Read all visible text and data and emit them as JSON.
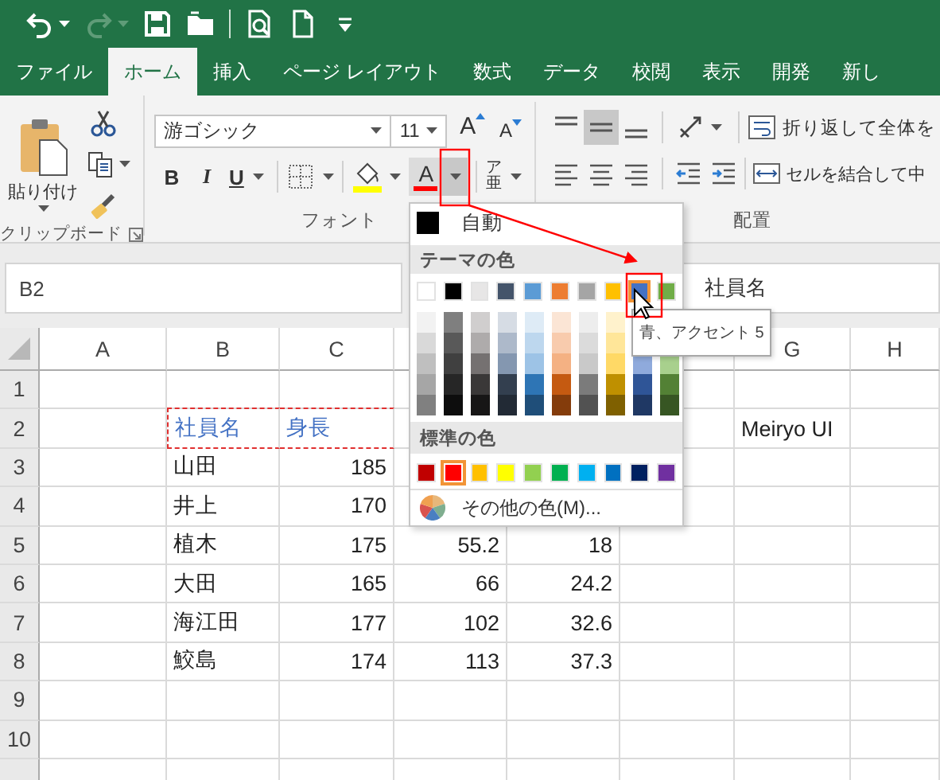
{
  "quick_access": [
    {
      "kind": "undo",
      "disabled": false
    },
    {
      "kind": "redo",
      "disabled": true
    },
    {
      "kind": "save",
      "disabled": false
    },
    {
      "kind": "open",
      "disabled": false
    },
    {
      "kind": "print_preview",
      "disabled": false
    },
    {
      "kind": "new",
      "disabled": false
    },
    {
      "kind": "customize",
      "disabled": false
    }
  ],
  "tabs": [
    {
      "label": "ファイル",
      "selected": false
    },
    {
      "label": "ホーム",
      "selected": true
    },
    {
      "label": "挿入",
      "selected": false
    },
    {
      "label": "ページ レイアウト",
      "selected": false
    },
    {
      "label": "数式",
      "selected": false
    },
    {
      "label": "データ",
      "selected": false
    },
    {
      "label": "校閲",
      "selected": false
    },
    {
      "label": "表示",
      "selected": false
    },
    {
      "label": "開発",
      "selected": false
    },
    {
      "label": "新し",
      "selected": false
    }
  ],
  "ribbon": {
    "clipboard": {
      "paste": "貼り付け",
      "label": "クリップボード"
    },
    "font": {
      "name": "游ゴシック",
      "size": "11",
      "grow": "A",
      "shrink": "A",
      "bold": "B",
      "italic": "I",
      "underline": "U",
      "font_color": "A",
      "font_color_menu_open": true,
      "phonetic_top": "ア",
      "phonetic_bottom": "亜",
      "label": "フォント"
    },
    "alignment": {
      "vertical": [
        {
          "kind": "top",
          "selected": false
        },
        {
          "kind": "middle",
          "selected": true
        },
        {
          "kind": "bottom",
          "selected": false
        }
      ],
      "wrap_text": "折り返して全体を",
      "merge": "セルを結合して中",
      "label": "配置"
    }
  },
  "formula_bar": {
    "name_box": "B2",
    "content": "社員名"
  },
  "sheet": {
    "columns": [
      "A",
      "B",
      "C",
      null,
      null,
      null,
      "G",
      "H"
    ],
    "rows": [
      {
        "header": "1",
        "cells": [
          null,
          null,
          null,
          null,
          null,
          null,
          null,
          null
        ]
      },
      {
        "header": "2",
        "cells": [
          null,
          {
            "text": "社員名",
            "kind": "preview",
            "marquee": true
          },
          {
            "text": "身長",
            "kind": "preview",
            "marquee": true
          },
          null,
          null,
          null,
          {
            "text": "Meiryo UI",
            "kind": "text",
            "marquee": false
          },
          null
        ]
      },
      {
        "header": "3",
        "cells": [
          null,
          {
            "text": "山田",
            "kind": "text",
            "marquee": false
          },
          {
            "text": "185",
            "kind": "number",
            "marquee": false
          },
          null,
          null,
          null,
          null,
          null
        ]
      },
      {
        "header": "4",
        "cells": [
          null,
          {
            "text": "井上",
            "kind": "text",
            "marquee": false
          },
          {
            "text": "170",
            "kind": "number",
            "marquee": false
          },
          null,
          null,
          null,
          null,
          null
        ]
      },
      {
        "header": "5",
        "cells": [
          null,
          {
            "text": "植木",
            "kind": "text",
            "marquee": false
          },
          {
            "text": "175",
            "kind": "number",
            "marquee": false
          },
          {
            "text": "55.2",
            "kind": "number",
            "marquee": false
          },
          {
            "text": "18",
            "kind": "number",
            "marquee": false
          },
          null,
          null,
          null
        ]
      },
      {
        "header": "6",
        "cells": [
          null,
          {
            "text": "大田",
            "kind": "text",
            "marquee": false
          },
          {
            "text": "165",
            "kind": "number",
            "marquee": false
          },
          {
            "text": "66",
            "kind": "number",
            "marquee": false
          },
          {
            "text": "24.2",
            "kind": "number",
            "marquee": false
          },
          null,
          null,
          null
        ]
      },
      {
        "header": "7",
        "cells": [
          null,
          {
            "text": "海江田",
            "kind": "text",
            "marquee": false
          },
          {
            "text": "177",
            "kind": "number",
            "marquee": false
          },
          {
            "text": "102",
            "kind": "number",
            "marquee": false
          },
          {
            "text": "32.6",
            "kind": "number",
            "marquee": false
          },
          null,
          null,
          null
        ]
      },
      {
        "header": "8",
        "cells": [
          null,
          {
            "text": "鮫島",
            "kind": "text",
            "marquee": false
          },
          {
            "text": "174",
            "kind": "number",
            "marquee": false
          },
          {
            "text": "113",
            "kind": "number",
            "marquee": false
          },
          {
            "text": "37.3",
            "kind": "number",
            "marquee": false
          },
          null,
          null,
          null
        ]
      },
      {
        "header": "9",
        "cells": [
          null,
          null,
          null,
          null,
          null,
          null,
          null,
          null
        ]
      },
      {
        "header": "10",
        "cells": [
          null,
          null,
          null,
          null,
          null,
          null,
          null,
          null
        ]
      }
    ]
  },
  "color_menu": {
    "automatic": "自動",
    "theme_heading": "テーマの色",
    "theme": [
      {
        "color": "#ffffff",
        "selected": false,
        "hovered": false,
        "shades": [
          {
            "color": "#f2f2f2"
          },
          {
            "color": "#d9d9d9"
          },
          {
            "color": "#bfbfbf"
          },
          {
            "color": "#a6a6a6"
          },
          {
            "color": "#808080"
          }
        ]
      },
      {
        "color": "#000000",
        "selected": false,
        "hovered": false,
        "shades": [
          {
            "color": "#7f7f7f"
          },
          {
            "color": "#595959"
          },
          {
            "color": "#404040"
          },
          {
            "color": "#262626"
          },
          {
            "color": "#0d0d0d"
          }
        ]
      },
      {
        "color": "#e7e6e6",
        "selected": false,
        "hovered": false,
        "shades": [
          {
            "color": "#d0cece"
          },
          {
            "color": "#aeabab"
          },
          {
            "color": "#757171"
          },
          {
            "color": "#3a3838"
          },
          {
            "color": "#171616"
          }
        ]
      },
      {
        "color": "#44546a",
        "selected": false,
        "hovered": false,
        "shades": [
          {
            "color": "#d6dce4"
          },
          {
            "color": "#adb9ca"
          },
          {
            "color": "#8497b0"
          },
          {
            "color": "#333f4f"
          },
          {
            "color": "#222a35"
          }
        ]
      },
      {
        "color": "#5b9bd5",
        "selected": false,
        "hovered": false,
        "shades": [
          {
            "color": "#deebf6"
          },
          {
            "color": "#bdd7ee"
          },
          {
            "color": "#9dc3e6"
          },
          {
            "color": "#2e75b5"
          },
          {
            "color": "#1f4e79"
          }
        ]
      },
      {
        "color": "#ed7d31",
        "selected": false,
        "hovered": false,
        "shades": [
          {
            "color": "#fbe5d5"
          },
          {
            "color": "#f8cbad"
          },
          {
            "color": "#f4b183"
          },
          {
            "color": "#c55a11"
          },
          {
            "color": "#843c0b"
          }
        ]
      },
      {
        "color": "#a5a5a5",
        "selected": false,
        "hovered": false,
        "shades": [
          {
            "color": "#ededed"
          },
          {
            "color": "#dbdbdb"
          },
          {
            "color": "#c9c9c9"
          },
          {
            "color": "#7b7b7b"
          },
          {
            "color": "#525252"
          }
        ]
      },
      {
        "color": "#ffc000",
        "selected": false,
        "hovered": false,
        "shades": [
          {
            "color": "#fff2cc"
          },
          {
            "color": "#ffe699"
          },
          {
            "color": "#ffd966"
          },
          {
            "color": "#bf9000"
          },
          {
            "color": "#7f6000"
          }
        ]
      },
      {
        "color": "#4472c4",
        "selected": false,
        "hovered": true,
        "shades": [
          {
            "color": "#8faadc"
          },
          {
            "color": "#2f5597"
          },
          {
            "color": "#1f3864"
          }
        ]
      },
      {
        "color": "#70ad47",
        "selected": false,
        "hovered": false,
        "shades": [
          {
            "color": "#a8d08d"
          },
          {
            "color": "#538135"
          },
          {
            "color": "#375623"
          }
        ]
      }
    ],
    "standard_heading": "標準の色",
    "standard": [
      {
        "color": "#c00000",
        "selected": false
      },
      {
        "color": "#ff0000",
        "selected": true
      },
      {
        "color": "#ffc000",
        "selected": false
      },
      {
        "color": "#ffff00",
        "selected": false
      },
      {
        "color": "#92d050",
        "selected": false
      },
      {
        "color": "#00b050",
        "selected": false
      },
      {
        "color": "#00b0f0",
        "selected": false
      },
      {
        "color": "#0070c0",
        "selected": false
      },
      {
        "color": "#002060",
        "selected": false
      },
      {
        "color": "#7030a0",
        "selected": false
      }
    ],
    "more": "その他の色(M)..."
  },
  "tooltip": "青、アクセント 5"
}
